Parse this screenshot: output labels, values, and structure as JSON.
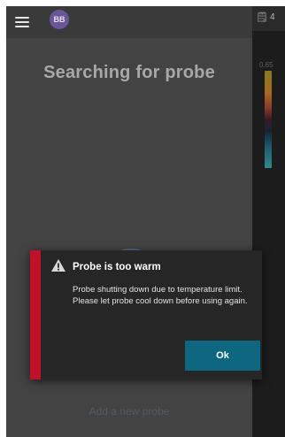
{
  "header": {
    "menu_icon": "hamburger-menu-icon",
    "avatar_initials": "BB"
  },
  "main": {
    "status_title": "Searching for probe",
    "add_probe_link": "Add a new probe"
  },
  "right_panel": {
    "icon": "probe-battery-icon",
    "count": "4",
    "scale_value": "0.65"
  },
  "dialog": {
    "icon": "warning-icon",
    "title": "Probe is too warm",
    "message": "Probe shutting down due to temperature limit. Please let probe cool down before using again.",
    "ok_label": "Ok"
  },
  "colors": {
    "dialog_accent": "#c0102a",
    "ok_button": "#0d6780",
    "panel_background": "#434343"
  }
}
